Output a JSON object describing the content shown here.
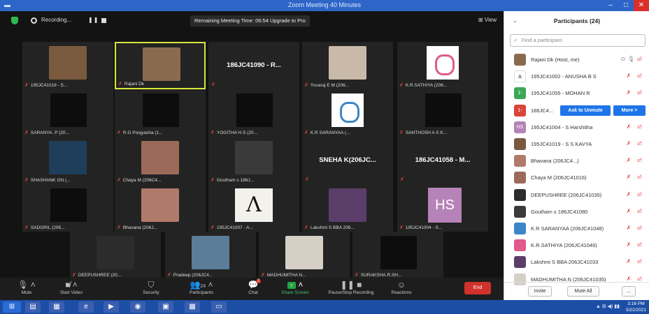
{
  "window": {
    "title": "Zoom Meeting 40 Minutes",
    "controls": {
      "minimize": "–",
      "maximize": "□",
      "close": "✕"
    }
  },
  "topbar": {
    "recording_label": "Recording...",
    "pause_glyph": "❚❚",
    "banner": "Remaining Meeting Time: 06:54  Upgrade to Pro",
    "view_label": "View"
  },
  "tiles": [
    {
      "name": "195JC41019 - S...",
      "kind": "photo",
      "color": "#7a5a3e"
    },
    {
      "name": "Rajani Dk",
      "kind": "photo",
      "color": "#8a6a4f",
      "highlight": true
    },
    {
      "name": "",
      "bigname": "186JC41090 - R...",
      "kind": "name"
    },
    {
      "name": "Yuvaraj E M (206...",
      "kind": "photo",
      "color": "#c9b9a8"
    },
    {
      "name": "K.R.SATHIYA (206...",
      "kind": "logo"
    },
    {
      "name": "SARANYA. P (20...",
      "kind": "black"
    },
    {
      "name": "R.G Poojyasha (1...",
      "kind": "black"
    },
    {
      "name": "YOGITHA H.S (20...",
      "kind": "black"
    },
    {
      "name": "K.R SARANYAA (...",
      "kind": "logo-blue"
    },
    {
      "name": "SANTHOSH A S K...",
      "kind": "black"
    },
    {
      "name": "SHASHANK GN (...",
      "kind": "photo",
      "color": "#1f3e5a"
    },
    {
      "name": "Chaya M (206C4...",
      "kind": "photo",
      "color": "#9c6a58"
    },
    {
      "name": "Goutham s 186J...",
      "kind": "photo",
      "color": "#3a3a3a"
    },
    {
      "name": "",
      "bigname": "SNEHA K(206JC...",
      "kind": "name"
    },
    {
      "name": "",
      "bigname": "186JC41058 - M...",
      "kind": "name"
    },
    {
      "name": "SADGRIL (206...",
      "kind": "black"
    },
    {
      "name": "Bhavana (206J...",
      "kind": "photo",
      "color": "#b07a6a"
    },
    {
      "name": "195JC41007 - A...",
      "kind": "letterA"
    },
    {
      "name": "Lakshmi S BBA 206...",
      "kind": "photo",
      "color": "#5b3d6a"
    },
    {
      "name": "195JC41004 - S...",
      "kind": "hs"
    },
    {
      "name": "DEEPUSHREE (20...",
      "kind": "photo",
      "color": "#2c2c2c"
    },
    {
      "name": "Pradeep (206JC4...",
      "kind": "photo",
      "color": "#5c7d9a"
    },
    {
      "name": "MADHUMITHA N...",
      "kind": "photo",
      "color": "#d5cfc6"
    },
    {
      "name": "SURAKSHA.R.SH...",
      "kind": "black"
    }
  ],
  "toolbar": {
    "mute": "Mute",
    "start_video": "Start Video",
    "security": "Security",
    "participants": "Participants",
    "participants_count": "24",
    "chat": "Chat",
    "chat_badge": "2",
    "share_screen": "Share Screen",
    "record": "Pause/Stop Recording",
    "reactions": "Reactions",
    "end": "End"
  },
  "panel": {
    "title": "Participants (24)",
    "search_placeholder": "Find a participant",
    "ask_to_unmute": "Ask to Unmute",
    "more": "More >",
    "participants": [
      {
        "name": "Rajani Dk (Host, me)",
        "avatar": "",
        "color": "#8a6a4f",
        "host": true
      },
      {
        "name": "195JC41002 - ANUSHA B S",
        "avatar": "A",
        "color": "#ffffff",
        "dark": true
      },
      {
        "name": "195JC41055 - MOHAN R",
        "avatar": "1-",
        "color": "#3aa857"
      },
      {
        "name": "186JC4...",
        "avatar": "1-",
        "color": "#d9443b",
        "hover": true
      },
      {
        "name": "195JC41004 - S Harshitha",
        "avatar": "HS",
        "color": "#b683b8"
      },
      {
        "name": "195JC41019 - S S KAVYA",
        "avatar": "",
        "color": "#7a5a3e"
      },
      {
        "name": "Bhavana (206JC4...)",
        "avatar": "",
        "color": "#b07a6a"
      },
      {
        "name": "Chaya M (206JC41016)",
        "avatar": "",
        "color": "#9c6a58"
      },
      {
        "name": "DEEPUSHREE (206JC41035)",
        "avatar": "",
        "color": "#2c2c2c"
      },
      {
        "name": "Goutham s 186JC41080",
        "avatar": "",
        "color": "#3a3a3a"
      },
      {
        "name": "K.R SARANYAA (206JC41048)",
        "avatar": "",
        "color": "#3d85c8"
      },
      {
        "name": "K.R.SATHIYA (206JC41046)",
        "avatar": "",
        "color": "#e05a8a"
      },
      {
        "name": "Lakshmi S BBA 206JC41033",
        "avatar": "",
        "color": "#5b3d6a"
      },
      {
        "name": "MADHUMITHA N (206JC41035)",
        "avatar": "",
        "color": "#d5cfc6"
      }
    ],
    "footer": {
      "invite": "Invite",
      "mute_all": "Mute All",
      "more": "..."
    }
  },
  "taskbar": {
    "time": "3:16 PM",
    "date": "5/22/2021",
    "tray": "▲ ⊞ ◀) ▮▮"
  }
}
